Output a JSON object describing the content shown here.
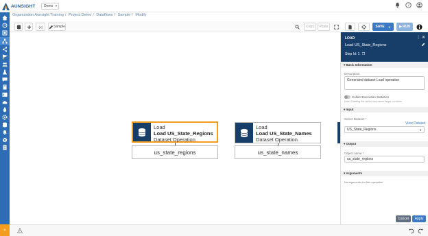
{
  "app": {
    "logo_text": "AUNSIGHT",
    "org_selector": "Demo"
  },
  "breadcrumb": [
    "Organization Aunsight Training",
    "Project Demo",
    "Dataflows",
    "Sample",
    "Modify"
  ],
  "toolbar": {
    "sample_label": "Sample",
    "copy_label": "Copy",
    "paste_label": "Paste",
    "save_label": "SAVE",
    "run_label": "RUN"
  },
  "nodes": [
    {
      "title": "Load",
      "name": "Load US_State_Regions",
      "type": "Dataset Operation",
      "output": "us_state_regions",
      "selected": true
    },
    {
      "title": "Load",
      "name": "Load US_State_Names",
      "type": "Dataset Operation",
      "output": "us_state_names",
      "selected": false
    }
  ],
  "panel": {
    "header_label": "LOAD",
    "name": "Load US_State_Regions",
    "step_label": "Step Id: 1",
    "basic_section": "Basic Information",
    "description_label": "Description",
    "description_value": "Generated dataset Load operation",
    "collect_label": "Collect Execution Statistics",
    "collect_note": "Note: Enabling this option may cause longer run times",
    "input_section": "Input",
    "select_dataset_label": "Select Dataset *",
    "view_dataset_link": "View Dataset",
    "dataset_value": "US_State_Regions",
    "output_section": "Output",
    "object_name_label": "Object name *",
    "object_name_value": "us_state_regions",
    "arguments_section": "Arguments",
    "arguments_empty": "No arguments for this operation",
    "cancel_label": "Cancel",
    "apply_label": "Apply"
  },
  "colors": {
    "sidebar": "#2d6db5",
    "node_icon": "#173d69",
    "selected": "#f39c1e",
    "accent": "#3b79c4"
  }
}
